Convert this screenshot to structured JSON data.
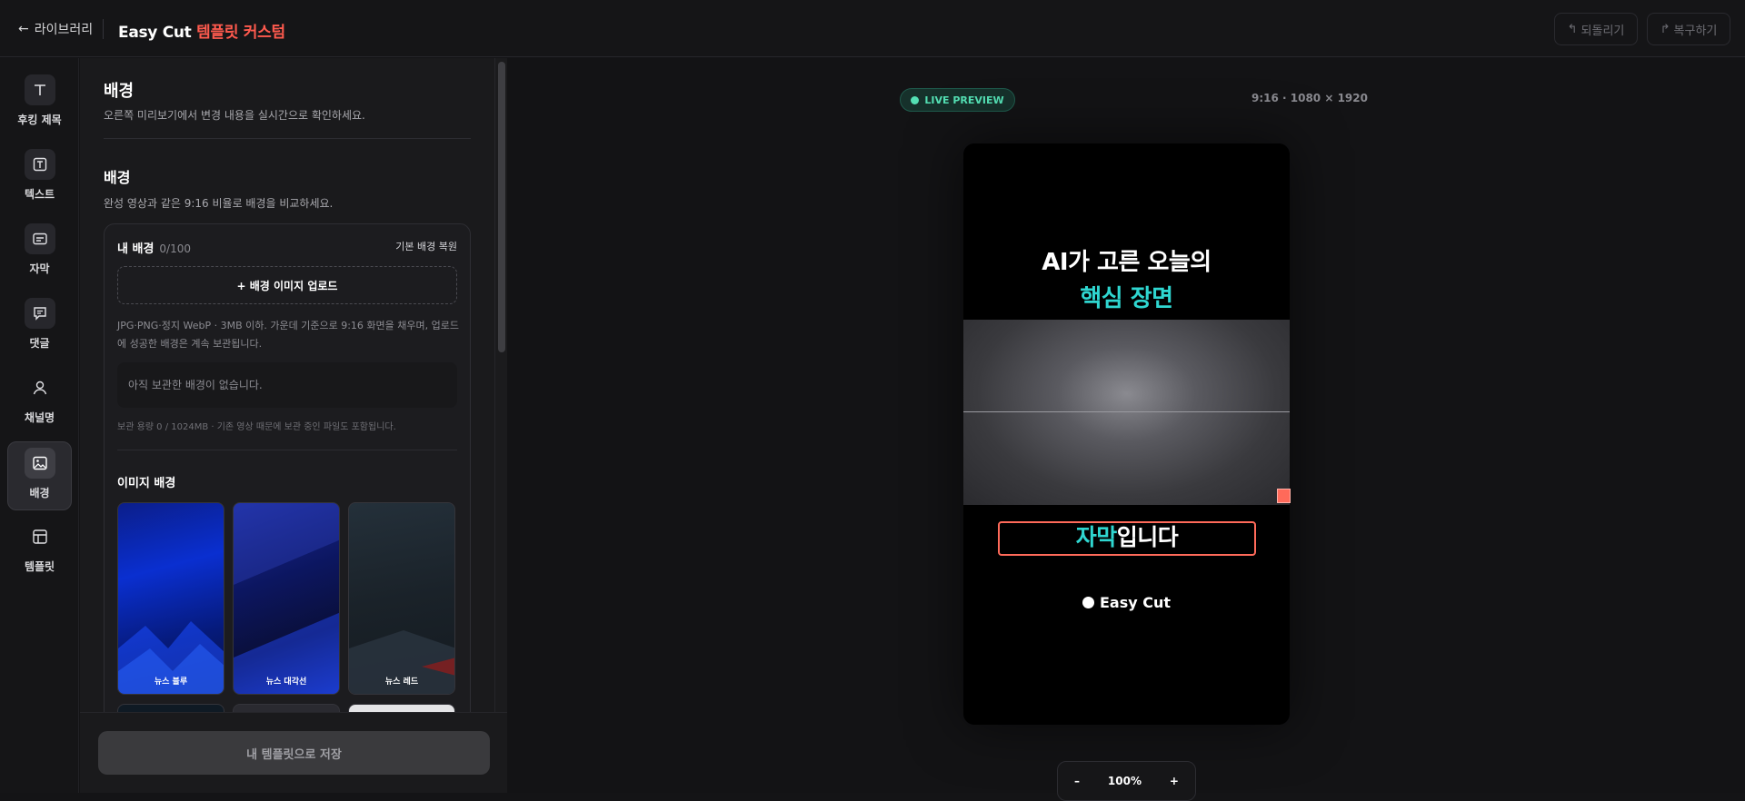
{
  "topbar": {
    "back_label": "라이브러리",
    "title_main": "Easy Cut",
    "title_accent": "템플릿 커스텀",
    "undo_label": "되돌리기",
    "redo_label": "복구하기"
  },
  "rail": {
    "items": [
      {
        "label": "후킹 제목",
        "icon": "text-t-icon"
      },
      {
        "label": "텍스트",
        "icon": "text-box-icon"
      },
      {
        "label": "자막",
        "icon": "subtitle-icon"
      },
      {
        "label": "댓글",
        "icon": "comment-icon"
      },
      {
        "label": "채널명",
        "icon": "user-icon"
      },
      {
        "label": "배경",
        "icon": "image-icon",
        "active": true
      },
      {
        "label": "템플릿",
        "icon": "layout-icon"
      }
    ]
  },
  "panel": {
    "title": "배경",
    "subtitle": "오른쪽 미리보기에서 변경 내용을 실시간으로 확인하세요.",
    "section_title": "배경",
    "section_subtitle": "완성 영상과 같은 9:16 비율로 배경을 비교하세요.",
    "my_bg": {
      "title": "내 배경",
      "count": "0/100",
      "restore_label": "기본 배경 복원",
      "upload_label": "+ 배경 이미지 업로드",
      "hint": "JPG·PNG·정지 WebP · 3MB 이하. 가운데 기준으로 9:16 화면을 채우며, 업로드에 성공한 배경은 계속 보관됩니다.",
      "empty_text": "아직 보관한 배경이 없습니다.",
      "storage_text": "보관 용량 0 / 1024MB · 기존 영상 때문에 보관 중인 파일도 포함됩니다."
    },
    "image_bg_title": "이미지 배경",
    "thumbnails": [
      {
        "label": "뉴스 블루"
      },
      {
        "label": "뉴스 대각선"
      },
      {
        "label": "뉴스 레드"
      }
    ],
    "save_label": "내 템플릿으로 저장"
  },
  "preview": {
    "live_label": "LIVE PREVIEW",
    "ratio_label": "9:16 · 1080 × 1920",
    "headline_line1": "AI가 고른 오늘의",
    "headline_line2": "핵심 장면",
    "caption_highlight": "자막",
    "caption_rest": "입니다",
    "brand_label": "Easy Cut",
    "zoom_minus": "–",
    "zoom_value": "100%",
    "zoom_plus": "+"
  },
  "colors": {
    "accent_red": "#ff5a4e",
    "accent_cyan": "#2fd6d0",
    "live_green": "#54e0b4"
  }
}
